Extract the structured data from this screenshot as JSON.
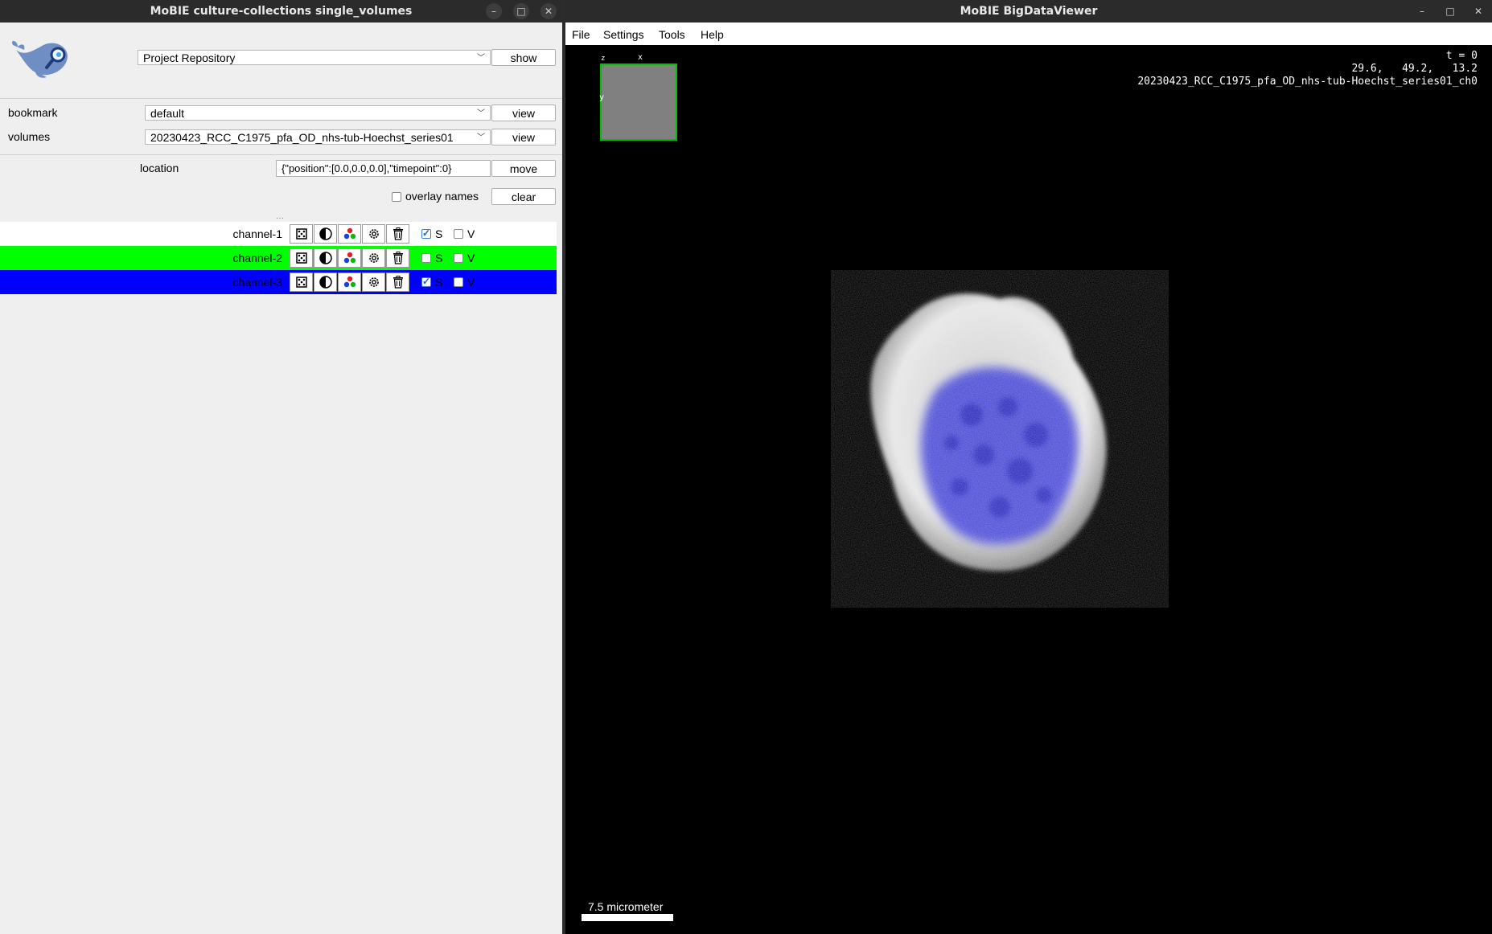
{
  "left_window": {
    "title": "MoBIE culture-collections single_volumes",
    "controls": {
      "minimize": "–",
      "maximize": "□",
      "close": "✕"
    },
    "repository_select": "Project Repository",
    "show_button": "show",
    "bookmark": {
      "label": "bookmark",
      "value": "default",
      "button": "view"
    },
    "volumes": {
      "label": "volumes",
      "value": "20230423_RCC_C1975_pfa_OD_nhs-tub-Hoechst_series01",
      "button": "view"
    },
    "location": {
      "label": "location",
      "value": "{\"position\":[0.0,0.0,0.0],\"timepoint\":0}",
      "button": "move"
    },
    "overlay_names": {
      "label": "overlay names",
      "checked": false
    },
    "clear_button": "clear",
    "channels": [
      {
        "name": "channel-1",
        "color": "#ffffff",
        "S": true,
        "V": false,
        "s_label": "S",
        "v_label": "V"
      },
      {
        "name": "channel-2",
        "color": "#00ff00",
        "S": false,
        "V": false,
        "s_label": "S",
        "v_label": "V"
      },
      {
        "name": "channel-3",
        "color": "#0000ff",
        "S": true,
        "V": false,
        "s_label": "S",
        "v_label": "V"
      }
    ],
    "channel_icons": [
      "focus-icon",
      "contrast-icon",
      "color-icon",
      "settings-icon",
      "delete-icon"
    ]
  },
  "right_window": {
    "title": "MoBIE BigDataViewer",
    "controls": {
      "minimize": "–",
      "maximize": "□",
      "close": "✕"
    },
    "menu": [
      "File",
      "Settings",
      "Tools",
      "Help"
    ],
    "timepoint": "t = 0",
    "coordinates": "29.6,   49.2,   13.2",
    "source_name": "20230423_RCC_C1975_pfa_OD_nhs-tub-Hoechst_series01_ch0",
    "navigator": {
      "x": "x",
      "y": "y",
      "z": "z"
    },
    "scale_bar": "7.5 micrometer"
  },
  "colors": {
    "titlebar": "#2b2b2b",
    "panel": "#efefef",
    "navigator_box": "#00c000"
  }
}
